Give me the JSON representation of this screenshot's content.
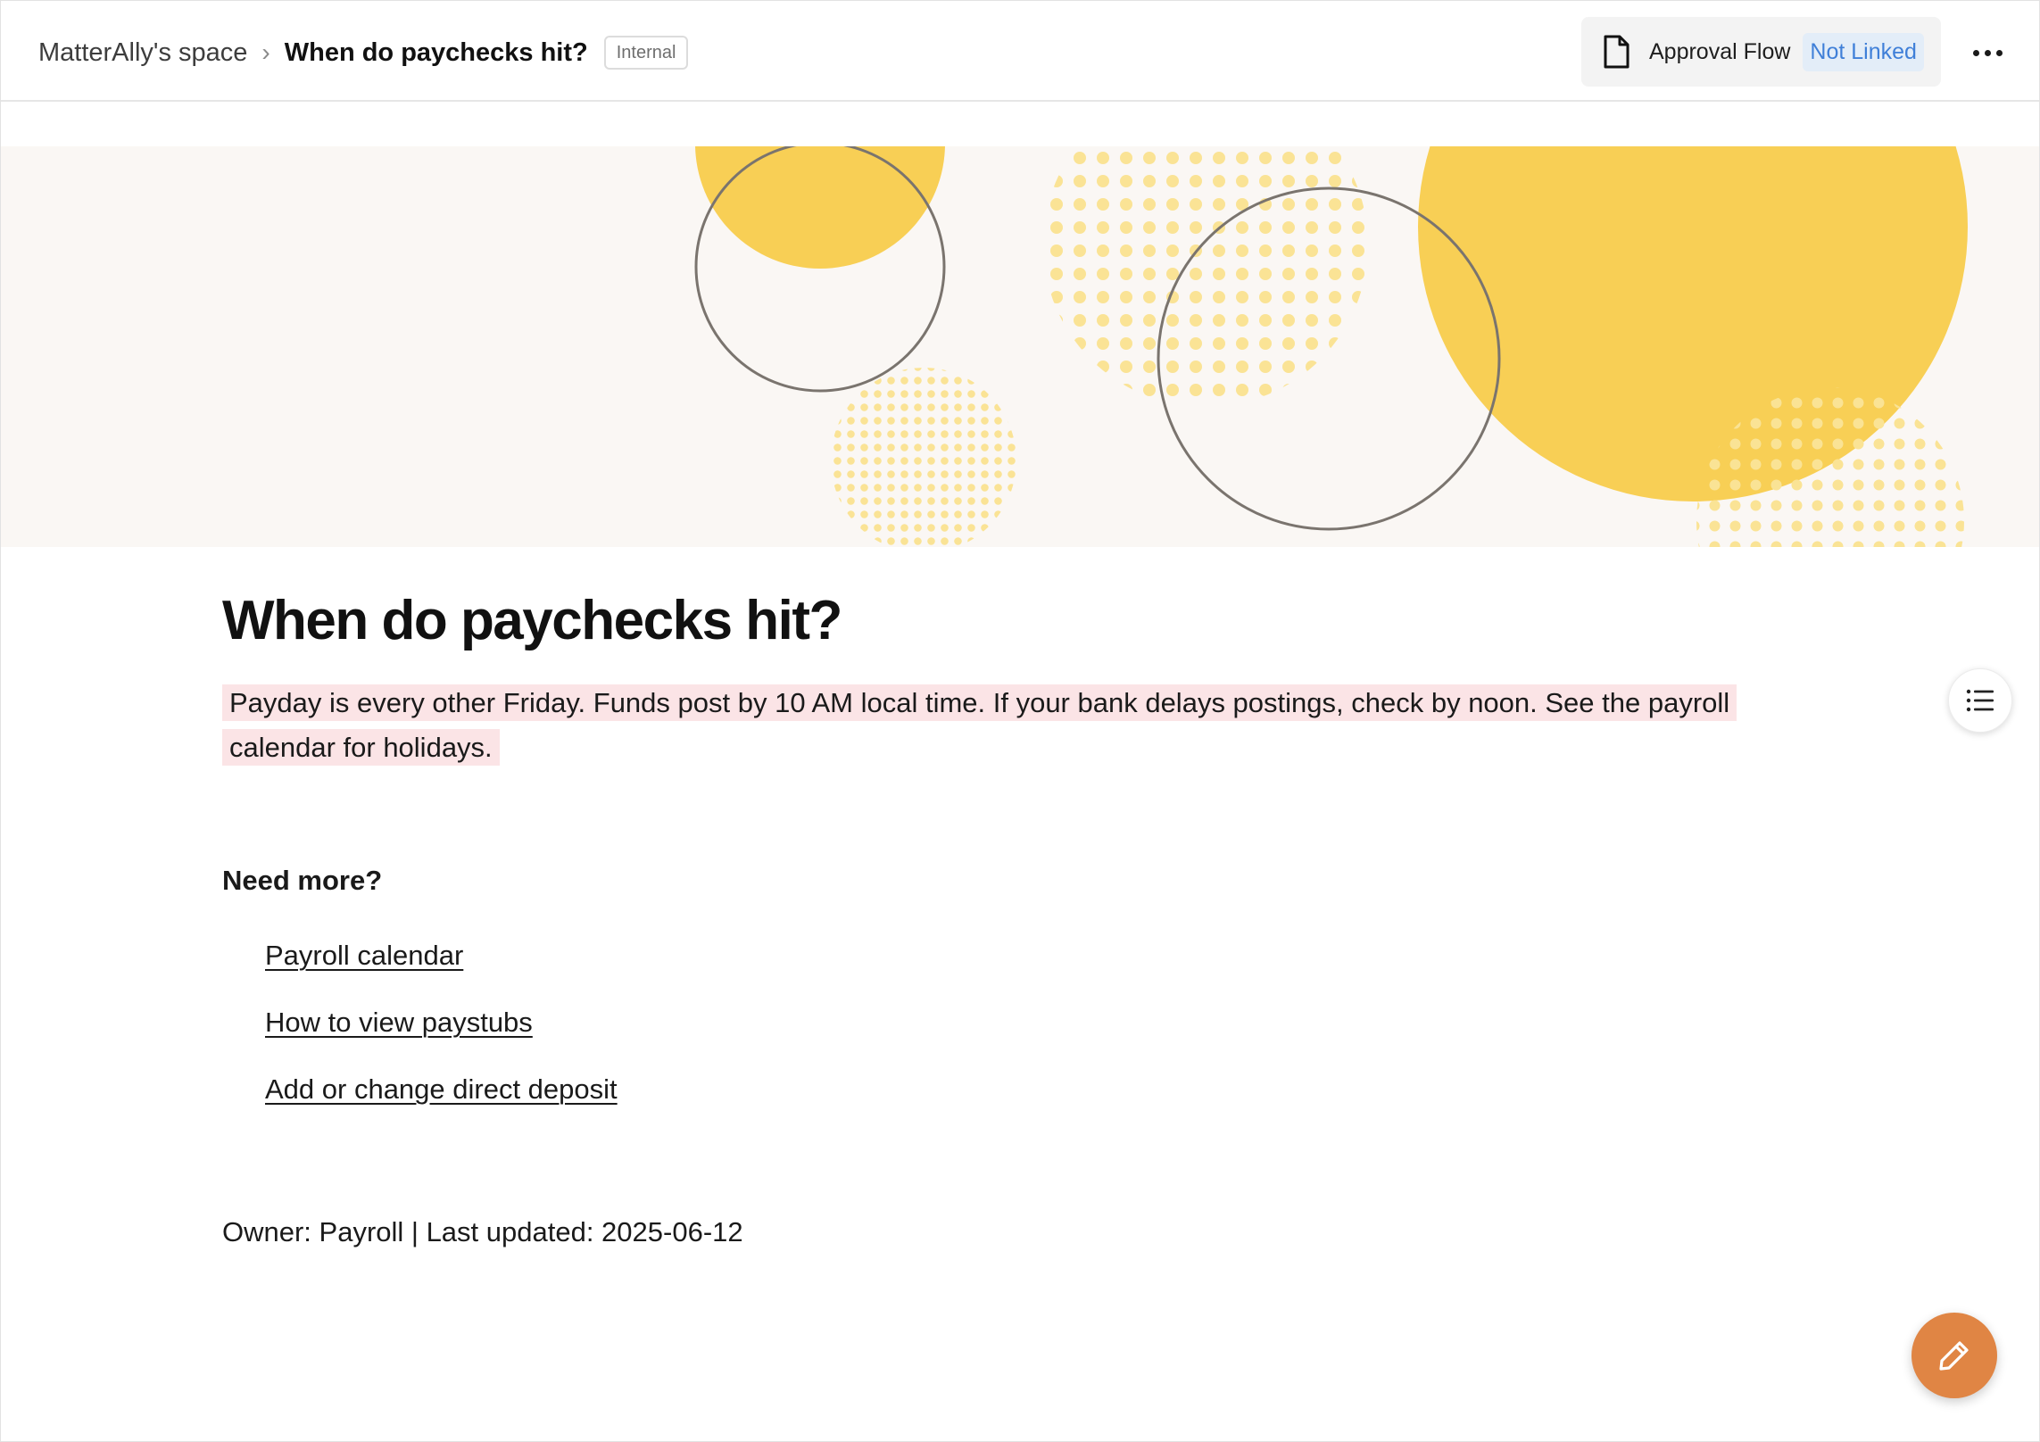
{
  "header": {
    "space_name": "MatterAlly's space",
    "separator": "›",
    "page_title": "When do paychecks hit?",
    "badge": "Internal",
    "approval": {
      "label": "Approval Flow",
      "status": "Not Linked",
      "icon": "document-icon"
    },
    "more_icon": "more-horizontal-icon"
  },
  "banner": {
    "colors": {
      "background": "#faf7f4",
      "yellow": "#f8cf55",
      "dots": "#fae395",
      "outline": "#7a746e"
    }
  },
  "article": {
    "title": "When do paychecks hit?",
    "summary": "Payday is every other Friday. Funds post by 10 AM local time. If your bank delays postings, check by noon. See the payroll calendar for holidays.",
    "section_heading": "Need more?",
    "links": [
      "Payroll calendar",
      "How to view paystubs",
      "Add or change direct deposit"
    ],
    "meta": "Owner: Payroll | Last updated: 2025-06-12"
  },
  "controls": {
    "toc_icon": "table-of-contents-icon",
    "edit_icon": "pencil-icon"
  },
  "colors": {
    "highlight": "#fbe4e6",
    "accent_link": "#3f7fd8",
    "fab": "#e08544"
  }
}
